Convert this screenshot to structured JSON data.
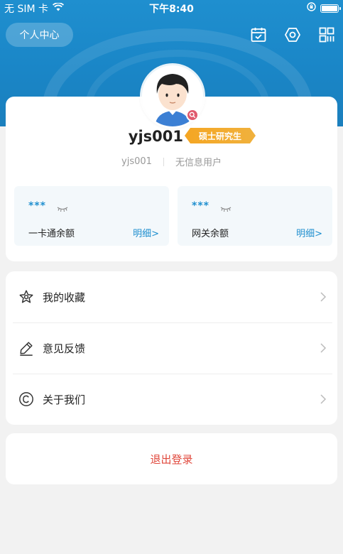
{
  "status_bar": {
    "carrier": "无 SIM 卡",
    "time": "下午8:40"
  },
  "header": {
    "title": "个人中心",
    "icons": [
      "calendar-check-icon",
      "settings-hexagon-icon",
      "qr-code-icon"
    ]
  },
  "profile": {
    "username": "yjs001",
    "degree": "硕士研究生",
    "account_id": "yjs001",
    "user_type": "无信息用户"
  },
  "balances": [
    {
      "value": "***",
      "label": "一卡通余额",
      "link": "明细>"
    },
    {
      "value": "***",
      "label": "网关余额",
      "link": "明细>"
    }
  ],
  "menu": {
    "items": [
      {
        "label": "我的收藏",
        "icon": "star-icon"
      },
      {
        "label": "意见反馈",
        "icon": "pencil-icon"
      },
      {
        "label": "关于我们",
        "icon": "copyright-icon"
      }
    ]
  },
  "logout": {
    "label": "退出登录"
  },
  "colors": {
    "accent": "#1f8fcf",
    "badge": "#f5a623",
    "logout": "#e0473b"
  }
}
